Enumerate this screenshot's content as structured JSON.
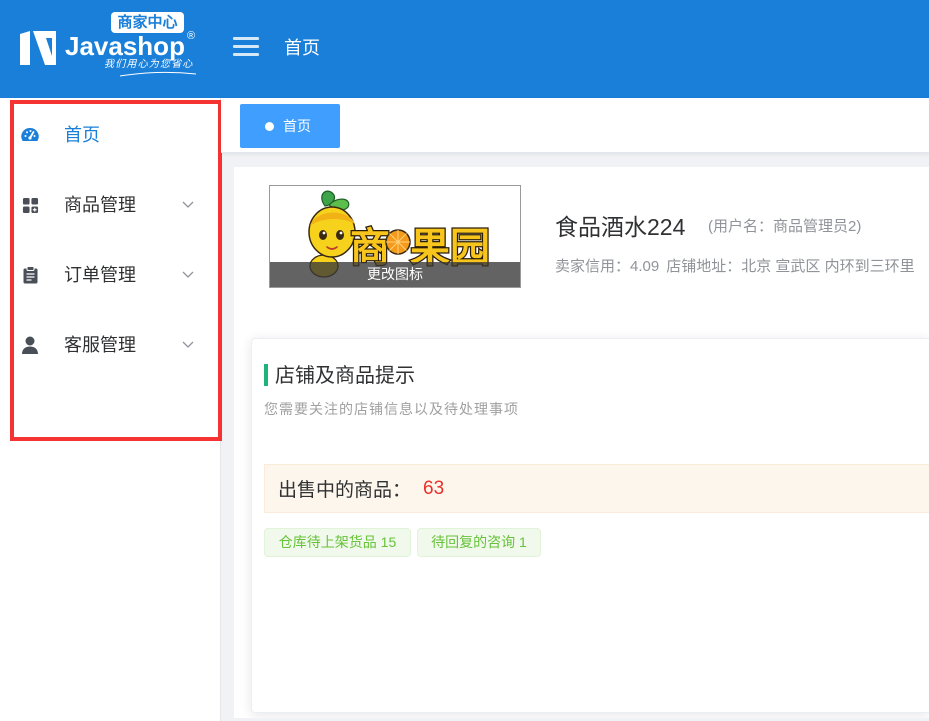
{
  "header": {
    "logo": {
      "name": "Javashop",
      "badge": "商家中心",
      "registered": "®",
      "slogan": "我们用心为您省心"
    },
    "menu_icon": "hamburger-icon",
    "title": "首页"
  },
  "sidebar": {
    "items": [
      {
        "label": "首页",
        "icon": "dashboard-icon",
        "active": true
      },
      {
        "label": "商品管理",
        "icon": "grid-icon",
        "expandable": true
      },
      {
        "label": "订单管理",
        "icon": "clipboard-icon",
        "expandable": true
      },
      {
        "label": "客服管理",
        "icon": "user-icon",
        "expandable": true
      }
    ]
  },
  "tabs": [
    {
      "label": "首页",
      "active": true
    }
  ],
  "shop": {
    "logo_chars": [
      "商",
      "果",
      "园"
    ],
    "change_logo": "更改图标",
    "name": "食品酒水224",
    "username": "(用户名：商品管理员2)",
    "credit_label": "卖家信用：",
    "credit": "4.09",
    "address_label": "店铺地址：",
    "address": "北京 宣武区 内环到三环里"
  },
  "tips": {
    "title": "店铺及商品提示",
    "subtitle": "您需要关注的店铺信息以及待处理事项",
    "on_sale_label": "出售中的商品：",
    "on_sale_count": "63",
    "tags": [
      {
        "label": "仓库待上架货品 15"
      },
      {
        "label": "待回复的咨询 1"
      }
    ]
  },
  "colors": {
    "header": "#1a7fd9",
    "accent": "#409eff",
    "active_menu": "#1a7fd9",
    "tip_bar": "#1fb27a",
    "on_sale_count": "#e8322d",
    "tag_text": "#67c23a",
    "highlight_frame": "#f53333"
  }
}
